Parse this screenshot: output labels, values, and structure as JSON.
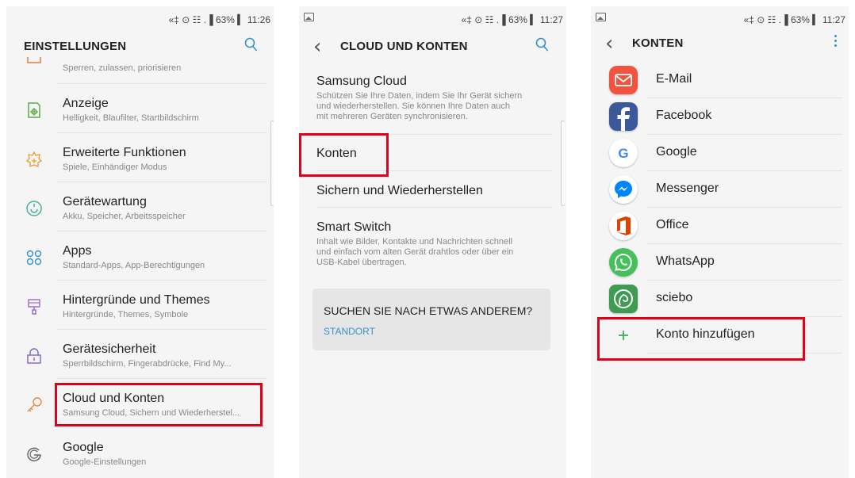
{
  "status_bar": {
    "left_screen": "«‡ ⊙ ☷ .▐ 63% ▍ 11:26",
    "middle_screen": "«‡ ⊙ ☷ .▐ 63% ▍ 11:27",
    "right_screen": "«‡ ⊙ ☷ .▐ 63% ▍ 11:27"
  },
  "settings": {
    "title": "EINSTELLUNGEN",
    "partial_subtitle": "Sperren, zulassen, priorisieren",
    "items": [
      {
        "title": "Anzeige",
        "subtitle": "Helligkeit, Blaufilter, Startbildschirm",
        "icon": "display-icon"
      },
      {
        "title": "Erweiterte Funktionen",
        "subtitle": "Spiele, Einhändiger Modus",
        "icon": "advanced-features-icon"
      },
      {
        "title": "Gerätewartung",
        "subtitle": "Akku, Speicher, Arbeitsspeicher",
        "icon": "device-maintenance-icon"
      },
      {
        "title": "Apps",
        "subtitle": "Standard-Apps, App-Berechtigungen",
        "icon": "apps-icon"
      },
      {
        "title": "Hintergründe und Themes",
        "subtitle": "Hintergründe, Themes, Symbole",
        "icon": "themes-icon"
      },
      {
        "title": "Gerätesicherheit",
        "subtitle": "Sperrbildschirm, Fingerabdrücke, Find My...",
        "icon": "lock-icon"
      },
      {
        "title": "Cloud und Konten",
        "subtitle": "Samsung Cloud, Sichern und Wiederherstel...",
        "icon": "key-icon"
      },
      {
        "title": "Google",
        "subtitle": "Google-Einstellungen",
        "icon": "google-g-icon"
      }
    ]
  },
  "cloud": {
    "title": "CLOUD UND KONTEN",
    "samsung_cloud": {
      "title": "Samsung Cloud",
      "desc1": "Schützen Sie Ihre Daten, indem Sie Ihr Gerät sichern",
      "desc2": "und wiederherstellen. Sie können Ihre Daten auch",
      "desc3": "mit mehreren Geräten synchronisieren."
    },
    "konten": "Konten",
    "backup": "Sichern und Wiederherstellen",
    "smart_switch": {
      "title": "Smart Switch",
      "desc1": "Inhalt wie Bilder, Kontakte und Nachrichten schnell",
      "desc2": "und einfach vom alten Gerät drahtlos oder über ein",
      "desc3": "USB-Kabel übertragen."
    },
    "suggest": {
      "heading": "SUCHEN SIE NACH ETWAS ANDEREM?",
      "link": "STANDORT"
    }
  },
  "accounts": {
    "title": "KONTEN",
    "items": [
      "E-Mail",
      "Facebook",
      "Google",
      "Messenger",
      "Office",
      "WhatsApp",
      "sciebo"
    ],
    "add": "Konto hinzufügen"
  },
  "colors": {
    "highlight": "#e3001b",
    "accent": "#3b8fc9"
  }
}
